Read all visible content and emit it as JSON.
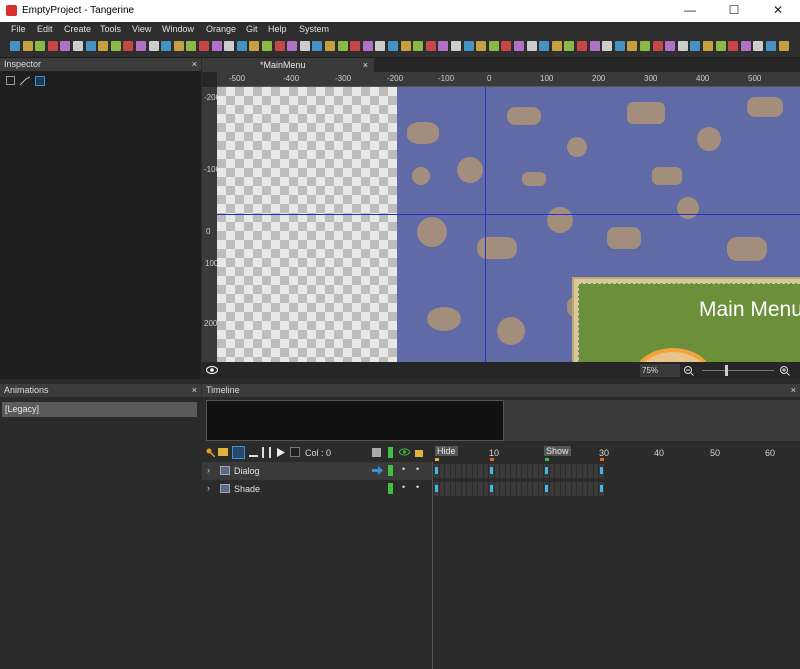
{
  "window": {
    "title": "EmptyProject - Tangerine",
    "minimize": "—",
    "maximize": "☐",
    "close": "✕"
  },
  "menu": [
    "File",
    "Edit",
    "Create",
    "Tools",
    "View",
    "Window",
    "Orange",
    "Git",
    "Help",
    "System"
  ],
  "toolbar_colors": [
    "#4aa3df",
    "#e0b341",
    "#9ad14b",
    "#e24b4b",
    "#c77de0",
    "#e8e8e8"
  ],
  "inspector": {
    "header": "Inspector",
    "close": "×",
    "icons": [
      "grid-icon",
      "curve-icon",
      "frame-icon"
    ]
  },
  "document_tab": {
    "label": "*MainMenu",
    "close": "×"
  },
  "rulers": {
    "horizontal": [
      "-500",
      "-400",
      "-300",
      "-200",
      "-100",
      "0",
      "100",
      "200",
      "300",
      "400",
      "500"
    ],
    "vertical": [
      "-200",
      "-100",
      "0",
      "100",
      "200"
    ]
  },
  "canvas": {
    "dialog_title": "Main Menu",
    "zoom": "75%"
  },
  "animations": {
    "header": "Animations",
    "close": "×",
    "items": [
      "[Legacy]"
    ]
  },
  "timeline": {
    "header": "Timeline",
    "close": "×",
    "col_label": "Col : 0",
    "markers": [
      "Hide",
      "Show"
    ],
    "frame_labels": [
      "10",
      "20",
      "30",
      "40",
      "50",
      "60"
    ],
    "tracks": [
      {
        "name": "Dialog",
        "keyframes": [
          0,
          10,
          20,
          30
        ]
      },
      {
        "name": "Shade",
        "keyframes": [
          0,
          10,
          20,
          30
        ]
      }
    ]
  },
  "colors": {
    "accent": "#3b8fd6",
    "keyframe": "#43b7e8",
    "background_blue": "#5f6aa6",
    "dialog_green": "#6c8f3a",
    "guide": "#2430c8"
  }
}
